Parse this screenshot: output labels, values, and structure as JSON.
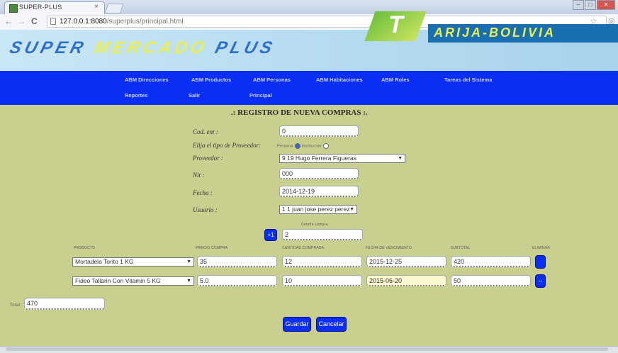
{
  "browser": {
    "tab_title": "SUPER-PLUS",
    "tab_close": "×",
    "url_host": "127.0.0.1:8080",
    "url_path": "/superplus/principal.html",
    "back": "←",
    "forward": "→",
    "reload": "C",
    "star": "☆",
    "menu": "◎",
    "minimize": "–",
    "maximize": "□",
    "close": "✕"
  },
  "banner": {
    "title_left": "SUPER ",
    "title_mid": "MERCADO",
    "title_right": " PLUS",
    "logo_letter": "T",
    "sub": "ARIJA-BOLIVIA"
  },
  "nav": {
    "items": [
      {
        "label": "ABM Direcciones"
      },
      {
        "label": "ABM Productos"
      },
      {
        "label": "ABM Personas"
      },
      {
        "label": "ABM Habitaciones"
      },
      {
        "label": "ABM Roles"
      },
      {
        "label": "Tareas del Sistema"
      },
      {
        "label": "Reportes"
      },
      {
        "label": "Salir"
      },
      {
        "label": "Principal"
      }
    ]
  },
  "form": {
    "title": ".: REGISTRO DE NUEVA COMPRAS :.",
    "cod_ent_label": "Cod. ent :",
    "cod_ent_value": "0",
    "tipo_label": "Elija el tipo de Proveedor:",
    "tipo_persona": "Persona",
    "tipo_institucion": "Institucion",
    "proveedor_label": "Proveedor :",
    "proveedor_value": "9 19 Hugo Ferrera Figueras",
    "nit_label": "Nit :",
    "nit_value": "000",
    "fecha_label": "Fecha :",
    "fecha_value": "2014-12-19",
    "usuario_label": "Usuario :",
    "usuario_value": "1 1 juan jose perez perez",
    "detalle_label": "Detalle compra",
    "detalle_btn": "+1",
    "detalle_value": "2"
  },
  "table": {
    "headers": [
      "PRODUCTO",
      "PRECIO COMPRA",
      "CANTIDAD COMPRADA",
      "FECHA DE VENCIMIENTO",
      "SUBTOTAL",
      "ELIMINAR"
    ],
    "rows": [
      {
        "producto": "Mortadela Torito 1 KG",
        "precio": "35",
        "cantidad": "12",
        "fecha": "2015-12-25",
        "subtotal": "420",
        "remove": ""
      },
      {
        "producto": "Fideo Tallarin Con Vitamin 5 KG",
        "precio": "5.0",
        "cantidad": "10",
        "fecha": "2015-06-20",
        "subtotal": "50",
        "remove": "--"
      }
    ]
  },
  "total": {
    "label": "Total :",
    "value": "470"
  },
  "buttons": {
    "save": "Guardar",
    "cancel": "Cancelar"
  }
}
